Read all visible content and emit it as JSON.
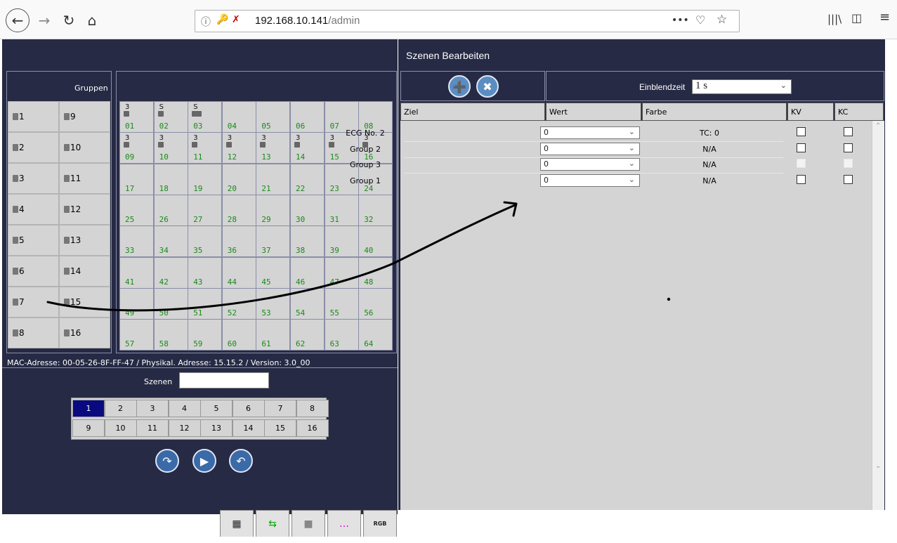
{
  "browser": {
    "url_host": "192.168.10.141",
    "url_path": "/admin",
    "page_actions": "•••"
  },
  "left": {
    "groups_label": "Gruppen",
    "groups": [
      "1",
      "2",
      "3",
      "4",
      "5",
      "6",
      "7",
      "8",
      "9",
      "10",
      "11",
      "12",
      "13",
      "14",
      "15",
      "16"
    ],
    "addresses": [
      "01",
      "02",
      "03",
      "04",
      "05",
      "06",
      "07",
      "08",
      "09",
      "10",
      "11",
      "12",
      "13",
      "14",
      "15",
      "16",
      "17",
      "18",
      "19",
      "20",
      "21",
      "22",
      "23",
      "24",
      "25",
      "26",
      "27",
      "28",
      "29",
      "30",
      "31",
      "32",
      "33",
      "34",
      "35",
      "36",
      "37",
      "38",
      "39",
      "40",
      "41",
      "42",
      "43",
      "44",
      "45",
      "46",
      "47",
      "48",
      "49",
      "50",
      "51",
      "52",
      "53",
      "54",
      "55",
      "56",
      "57",
      "58",
      "59",
      "60",
      "61",
      "62",
      "63",
      "64"
    ],
    "info": "MAC-Adresse: 00-05-26-8F-FF-47 / Physikal. Adresse: 15.15.2 / Version: 3.0_00",
    "scenes_label": "Szenen",
    "scene_numbers": [
      "1",
      "2",
      "3",
      "4",
      "5",
      "6",
      "7",
      "8",
      "9",
      "10",
      "11",
      "12",
      "13",
      "14",
      "15",
      "16"
    ],
    "active_scene": "1",
    "marker_3": "3",
    "marker_s": "S"
  },
  "right": {
    "title": "Szenen Bearbeiten",
    "fade_label": "Einblendzeit",
    "fade_value": "1 s",
    "headers": {
      "ziel": "Ziel",
      "wert": "Wert",
      "farbe": "Farbe",
      "kv": "KV",
      "kc": "KC"
    },
    "rows": [
      {
        "ziel": "ECG No. 2",
        "wert": "0",
        "farbe": "TC: 0",
        "kv_enabled": true,
        "kc_enabled": true
      },
      {
        "ziel": "Group 2",
        "wert": "0",
        "farbe": "N/A",
        "kv_enabled": true,
        "kc_enabled": true
      },
      {
        "ziel": "Group 3",
        "wert": "0",
        "farbe": "N/A",
        "kv_enabled": false,
        "kc_enabled": false
      },
      {
        "ziel": "Group 1",
        "wert": "0",
        "farbe": "N/A",
        "kv_enabled": true,
        "kc_enabled": true
      }
    ]
  },
  "bottom_tabs": [
    "RGB"
  ]
}
